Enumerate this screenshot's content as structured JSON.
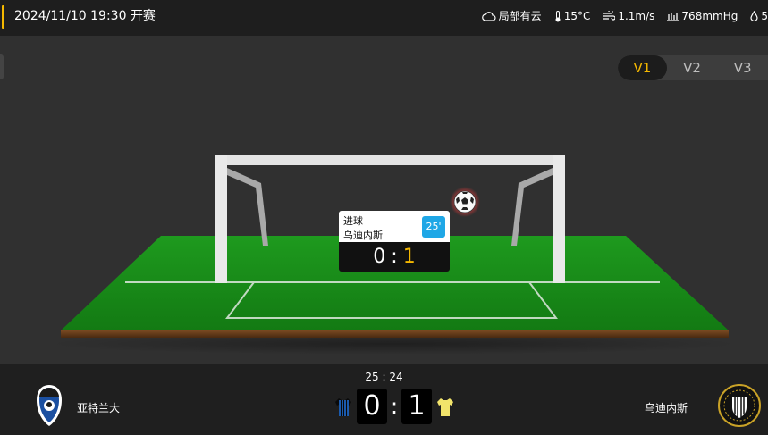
{
  "header": {
    "kickoff_text": "2024/11/10 19:30 开赛",
    "weather": {
      "condition": "局部有云",
      "temperature": "15°C",
      "wind": "1.1m/s",
      "pressure": "768mmHg",
      "humidity": "5"
    }
  },
  "view_tabs": [
    {
      "label": "V1",
      "active": true
    },
    {
      "label": "V2",
      "active": false
    },
    {
      "label": "V3",
      "active": false
    }
  ],
  "event": {
    "title": "进球",
    "team": "乌迪内斯",
    "minute": "25'",
    "home_score": "0",
    "separator": ":",
    "away_score": "1"
  },
  "match": {
    "clock": "25 : 24",
    "home_team": "亚特兰大",
    "away_team": "乌迪内斯",
    "home_score": "0",
    "away_score": "1",
    "score_separator": ":"
  },
  "colors": {
    "accent": "#f5b800",
    "minute_badge": "#1fa7e6",
    "pitch_green": "#1a8a1a",
    "home_kit": "#1f6fd6",
    "away_kit": "#f2e46b"
  },
  "icons": {
    "weather_condition": "cloud-icon",
    "temperature": "thermometer-icon",
    "wind": "wind-icon",
    "pressure": "pressure-icon",
    "humidity": "drop-icon",
    "ball": "soccer-ball-icon"
  }
}
